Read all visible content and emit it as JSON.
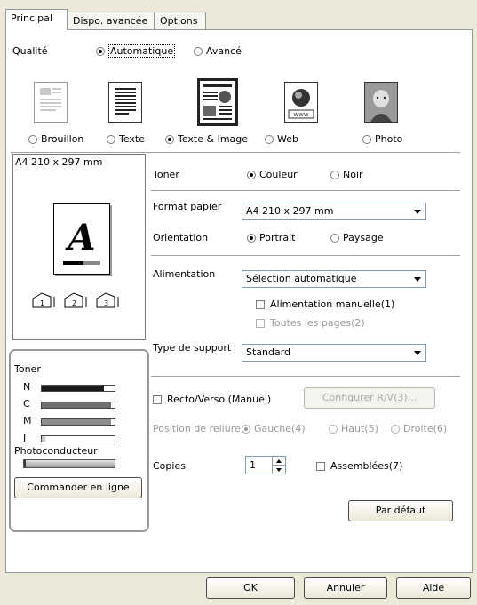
{
  "tabs": [
    {
      "label": "Principal"
    },
    {
      "label": "Dispo. avancée"
    },
    {
      "label": "Options"
    }
  ],
  "quality": {
    "label": "Qualité",
    "mode_auto": "Automatique",
    "mode_adv": "Avancé",
    "presets": [
      {
        "label": "Brouillon"
      },
      {
        "label": "Texte"
      },
      {
        "label": "Texte & Image"
      },
      {
        "label": "Web"
      },
      {
        "label": "Photo"
      }
    ]
  },
  "preview": {
    "paper_label": "A4 210 x 297 mm",
    "glyph": "A"
  },
  "toner": {
    "label": "Toner",
    "color_label": "Couleur",
    "mono_label": "Noir"
  },
  "paper_format": {
    "label": "Format papier",
    "value": "A4 210 x 297 mm"
  },
  "orientation": {
    "label": "Orientation",
    "portrait": "Portrait",
    "landscape": "Paysage"
  },
  "feed": {
    "label": "Alimentation",
    "value": "Sélection automatique",
    "manual_label": "Alimentation manuelle(1)",
    "all_pages_label": "Toutes les pages(2)"
  },
  "media_type": {
    "label": "Type de support",
    "value": "Standard"
  },
  "duplex": {
    "label": "Recto/Verso (Manuel)",
    "configure_label": "Configurer R/V(3)...",
    "binding_label": "Position de reliure",
    "left_label": "Gauche(4)",
    "top_label": "Haut(5)",
    "right_label": "Droite(6)"
  },
  "copies": {
    "label": "Copies",
    "value": "1",
    "collate_label": "Assemblées(7)"
  },
  "default_button": "Par défaut",
  "consumables": {
    "toner_title": "Toner",
    "inks": [
      {
        "label": "N",
        "level": 0.85,
        "color": "#1a1a1a"
      },
      {
        "label": "C",
        "level": 0.95,
        "color": "#707070"
      },
      {
        "label": "M",
        "level": 0.95,
        "color": "#8c8c8c"
      },
      {
        "label": "J",
        "level": 0.05,
        "color": "#c8c8c8"
      }
    ],
    "photoconductor_label": "Photoconducteur",
    "photoconductor_level": 0.02,
    "order_button": "Commander en ligne"
  },
  "footer": {
    "ok": "OK",
    "cancel": "Annuler",
    "help": "Aide"
  }
}
